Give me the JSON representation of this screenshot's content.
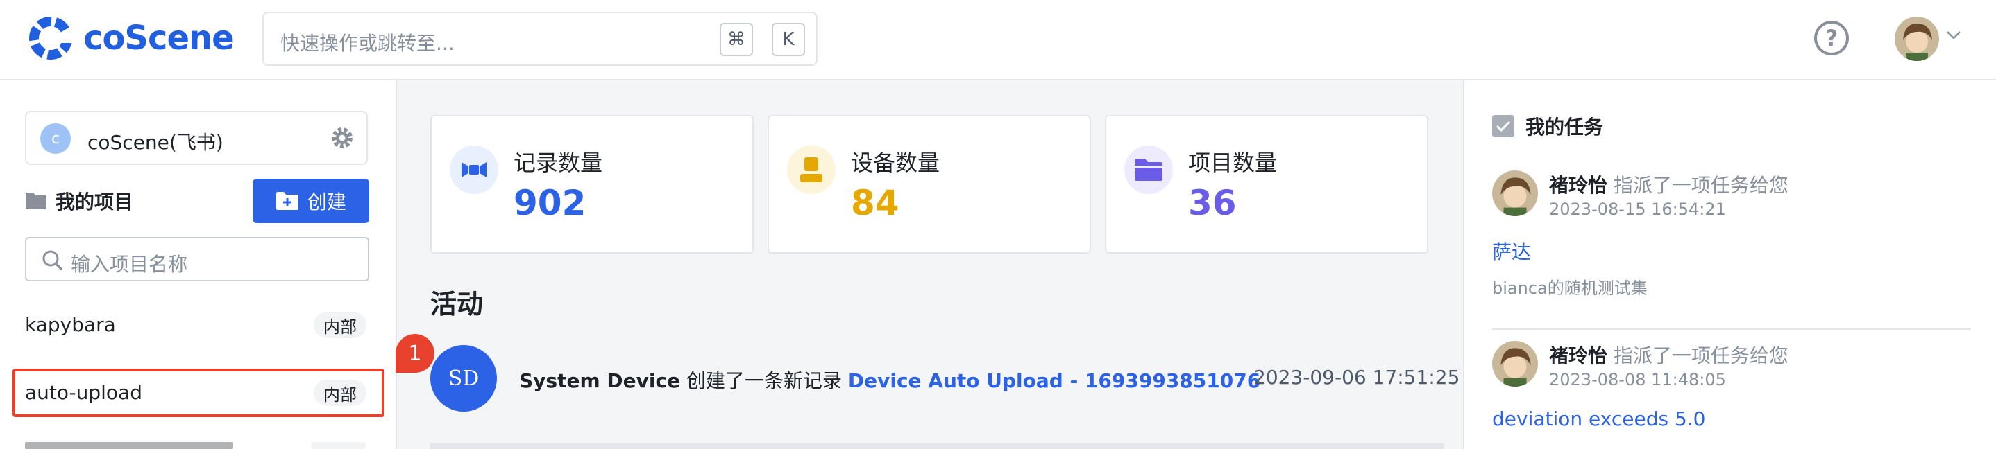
{
  "header": {
    "logo_text": "coScene",
    "search_placeholder": "快速操作或跳转至...",
    "shortcut_cmd": "⌘",
    "shortcut_key": "K",
    "help_glyph": "?"
  },
  "sidebar": {
    "org_initial": "c",
    "org_name": "coScene(飞书)",
    "projects_label": "我的项目",
    "create_label": "创建",
    "project_search_placeholder": "输入项目名称",
    "projects": [
      {
        "name": "kapybara",
        "tag": "内部"
      },
      {
        "name": "auto-upload",
        "tag": "内部"
      }
    ]
  },
  "stats": [
    {
      "label": "记录数量",
      "value": "902",
      "color": "#2b62e6",
      "icon": "record-icon"
    },
    {
      "label": "设备数量",
      "value": "84",
      "color": "#e5a800",
      "icon": "device-icon"
    },
    {
      "label": "项目数量",
      "value": "36",
      "color": "#6b5ce7",
      "icon": "folder-icon"
    }
  ],
  "activity": {
    "title": "活动",
    "badge": "1",
    "items": [
      {
        "avatar": "SD",
        "actor": "System Device",
        "verb": " 创建了一条新记录 ",
        "link": "Device Auto Upload - 1693993851076",
        "time": "2023-09-06 17:51:25"
      }
    ]
  },
  "tasks": {
    "title": "我的任务",
    "items": [
      {
        "user": "褚玲怡",
        "action": " 指派了一项任务给您",
        "time": "2023-08-15 16:54:21",
        "title": "萨达",
        "sub": "bianca的随机测试集"
      },
      {
        "user": "褚玲怡",
        "action": " 指派了一项任务给您",
        "time": "2023-08-08 11:48:05",
        "title": "deviation exceeds 5.0",
        "sub": ""
      }
    ]
  },
  "colors": {
    "brand": "#1f5fe0",
    "primary": "#2b62e6",
    "highlight": "#e8412e"
  }
}
